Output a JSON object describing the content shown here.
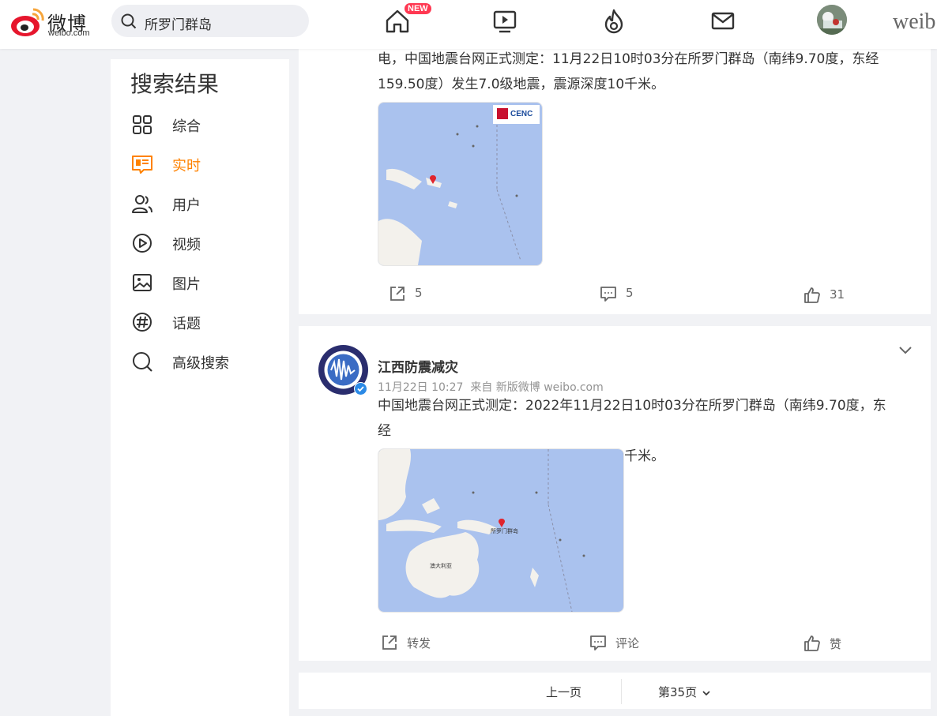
{
  "header": {
    "logo_text": "微博",
    "logo_sub": "weibo.com",
    "search_value": "所罗门群岛",
    "badge_new": "NEW",
    "brand_word": "weib",
    "icons": [
      "home-icon",
      "video-icon",
      "hot-icon",
      "mail-icon"
    ]
  },
  "sidebar": {
    "title": "搜索结果",
    "items": [
      {
        "label": "综合",
        "icon": "grid-icon"
      },
      {
        "label": "实时",
        "icon": "realtime-icon",
        "active": true
      },
      {
        "label": "用户",
        "icon": "users-icon"
      },
      {
        "label": "视频",
        "icon": "play-icon"
      },
      {
        "label": "图片",
        "icon": "image-icon"
      },
      {
        "label": "话题",
        "icon": "topic-icon"
      },
      {
        "label": "高级搜索",
        "icon": "search-icon"
      }
    ]
  },
  "post1": {
    "text_line1": "电，中国地震台网正式测定：11月22日10时03分在所罗门群岛（南纬9.70度，东经",
    "text_line2": "159.50度）发生7.0级地震，震源深度10千米。",
    "map_logo": "CENC",
    "repost": "5",
    "comment": "5",
    "like": "31"
  },
  "post2": {
    "author": "江西防震减灾",
    "meta": "11月22日 10:27  来自 新版微博 weibo.com",
    "text_line1": "中国地震台网正式测定：2022年11月22日10时03分在所罗门群岛（南纬9.70度，东经",
    "text_line2": "159.50度）发生7.0级地震，震源深度10千米。",
    "map_label_main": "所罗门群岛",
    "map_label_australia": "澳大利亚",
    "repost": "转发",
    "comment": "评论",
    "like": "赞"
  },
  "pager": {
    "prev": "上一页",
    "current": "第35页"
  },
  "colors": {
    "accent": "#ff8200",
    "map_sea": "#aac2ee",
    "map_land": "#f3f1ec"
  }
}
